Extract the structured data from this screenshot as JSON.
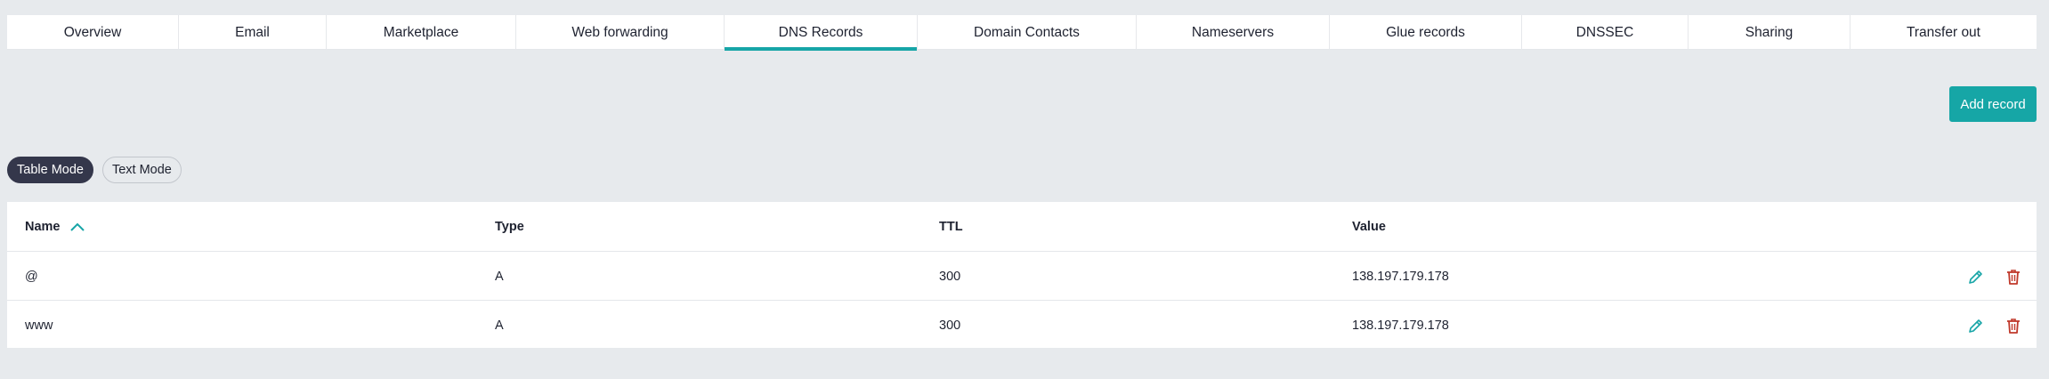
{
  "tabs": [
    {
      "label": "Overview"
    },
    {
      "label": "Email"
    },
    {
      "label": "Marketplace"
    },
    {
      "label": "Web forwarding"
    },
    {
      "label": "DNS Records"
    },
    {
      "label": "Domain Contacts"
    },
    {
      "label": "Nameservers"
    },
    {
      "label": "Glue records"
    },
    {
      "label": "DNSSEC"
    },
    {
      "label": "Sharing"
    },
    {
      "label": "Transfer out"
    }
  ],
  "active_tab": "DNS Records",
  "toolbar": {
    "add_record_label": "Add record"
  },
  "modes": {
    "table_label": "Table Mode",
    "text_label": "Text Mode",
    "active": "Table Mode"
  },
  "table": {
    "columns": {
      "name": "Name",
      "type": "Type",
      "ttl": "TTL",
      "value": "Value"
    },
    "sort": {
      "column": "Name",
      "direction": "ascending"
    },
    "rows": [
      {
        "name": "@",
        "type": "A",
        "ttl": "300",
        "value": "138.197.179.178"
      },
      {
        "name": "www",
        "type": "A",
        "ttl": "300",
        "value": "138.197.179.178"
      }
    ]
  },
  "colors": {
    "accent": "#16a6a6",
    "active_mode": "#34374b",
    "delete": "#c0392b",
    "edit": "#17a5a7",
    "background": "#e7eaed"
  },
  "icons": {
    "sort": "chevron-up-icon",
    "edit": "pencil-icon",
    "delete": "trash-icon"
  }
}
